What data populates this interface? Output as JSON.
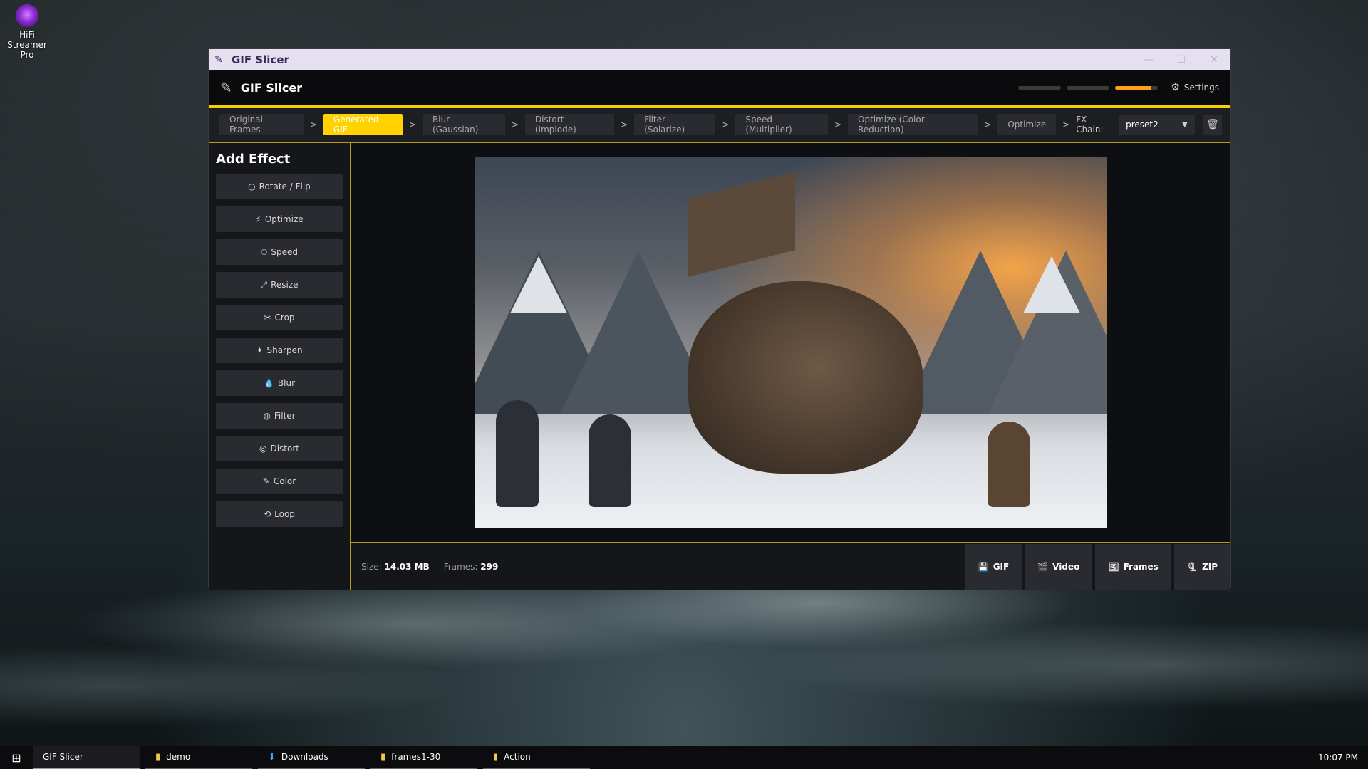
{
  "desktop": {
    "icon_label": "HiFi Streamer Pro"
  },
  "window": {
    "title": "GIF Slicer",
    "controls": {
      "minimize": "—",
      "maximize": "☐",
      "close": "✕"
    }
  },
  "app_header": {
    "title": "GIF Slicer",
    "progress": {
      "step_count": 3,
      "active_step": 3,
      "active_fill": 0.85
    },
    "settings_label": "Settings"
  },
  "breadcrumbs": {
    "items": [
      {
        "label": "Original Frames",
        "active": false
      },
      {
        "label": "Generated GIF",
        "active": true
      },
      {
        "label": "Blur (Gaussian)",
        "active": false
      },
      {
        "label": "Distort (Implode)",
        "active": false
      },
      {
        "label": "Filter (Solarize)",
        "active": false
      },
      {
        "label": "Speed (Multiplier)",
        "active": false
      },
      {
        "label": "Optimize (Color Reduction)",
        "active": false
      },
      {
        "label": "Optimize",
        "active": false
      }
    ],
    "separator": ">",
    "fx_chain_label": "FX Chain:",
    "fx_chain_value": "preset2"
  },
  "sidebar": {
    "title": "Add Effect",
    "effects": [
      {
        "label": "Rotate / Flip",
        "icon": "rotate-icon",
        "glyph": "○"
      },
      {
        "label": "Optimize",
        "icon": "lightning-icon",
        "glyph": "⚡"
      },
      {
        "label": "Speed",
        "icon": "timer-icon",
        "glyph": "⏱"
      },
      {
        "label": "Resize",
        "icon": "resize-icon",
        "glyph": "⤢"
      },
      {
        "label": "Crop",
        "icon": "crop-icon",
        "glyph": "✂"
      },
      {
        "label": "Sharpen",
        "icon": "sharpen-icon",
        "glyph": "✦"
      },
      {
        "label": "Blur",
        "icon": "droplet-icon",
        "glyph": "💧"
      },
      {
        "label": "Filter",
        "icon": "palette-icon",
        "glyph": "◍"
      },
      {
        "label": "Distort",
        "icon": "target-icon",
        "glyph": "◎"
      },
      {
        "label": "Color",
        "icon": "brush-icon",
        "glyph": "✎"
      },
      {
        "label": "Loop",
        "icon": "loop-icon",
        "glyph": "⟲"
      }
    ]
  },
  "status": {
    "size_label": "Size:",
    "size_value": "14.03 MB",
    "frames_label": "Frames:",
    "frames_value": "299"
  },
  "downloads": [
    {
      "label": "GIF",
      "icon": "save-icon",
      "glyph": "💾"
    },
    {
      "label": "Video",
      "icon": "video-icon",
      "glyph": "🎬"
    },
    {
      "label": "Frames",
      "icon": "frames-icon",
      "glyph": "🖼"
    },
    {
      "label": "ZIP",
      "icon": "zip-icon",
      "glyph": "🗜"
    }
  ],
  "taskbar": {
    "items": [
      {
        "label": "GIF Slicer",
        "icon": "app-icon",
        "glyph": "",
        "active": true
      },
      {
        "label": "demo",
        "icon": "folder-icon",
        "glyph": "▮",
        "active": false
      },
      {
        "label": "Downloads",
        "icon": "download-icon",
        "glyph": "⬇",
        "active": false
      },
      {
        "label": "frames1-30",
        "icon": "folder-icon",
        "glyph": "▮",
        "active": false
      },
      {
        "label": "Action",
        "icon": "folder-icon",
        "glyph": "▮",
        "active": false
      }
    ],
    "clock": "10:07 PM"
  },
  "colors": {
    "accent": "#ffd200",
    "progress_active": "#ff9e1f",
    "window_bg": "#15161a"
  }
}
